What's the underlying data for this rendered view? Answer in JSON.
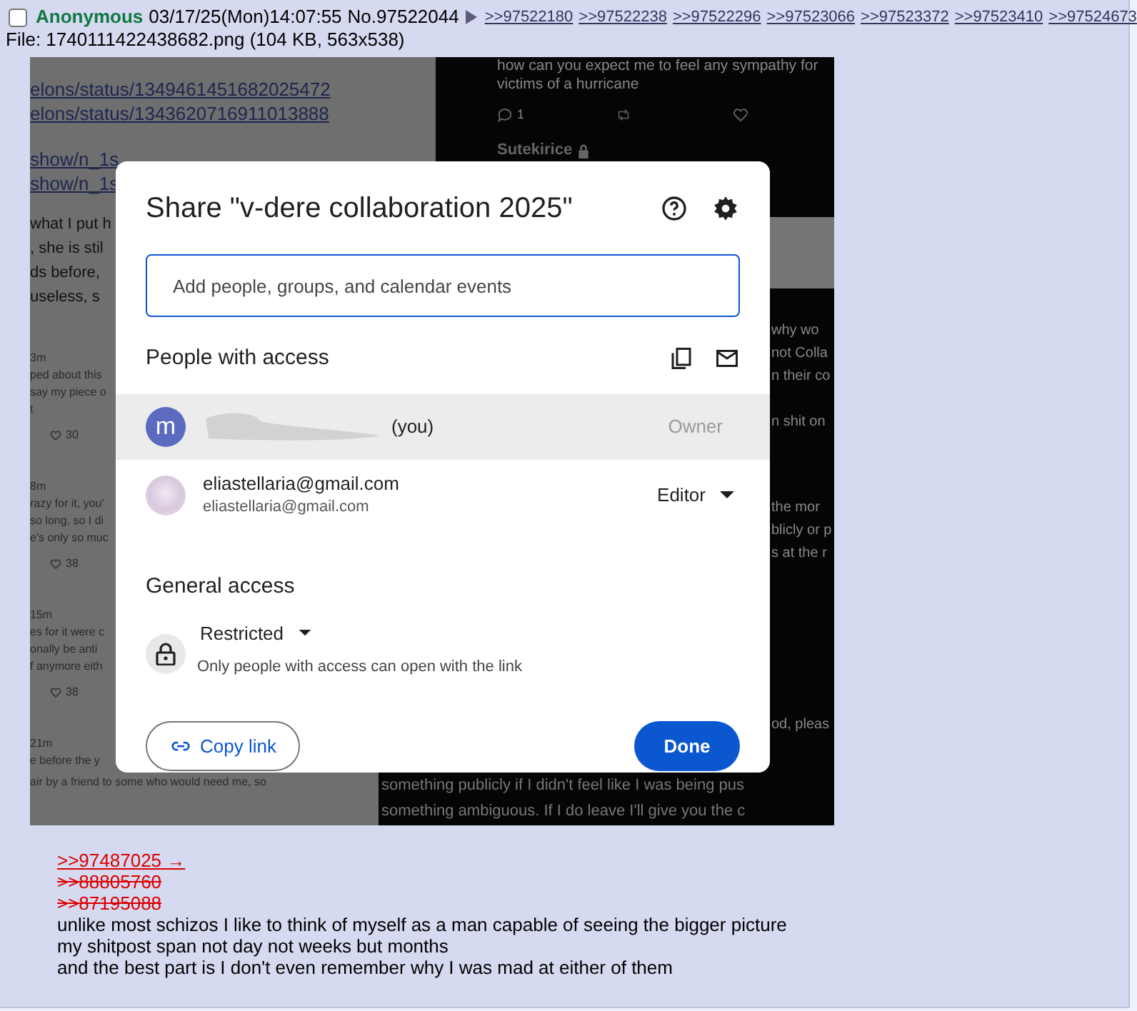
{
  "post": {
    "checked": false,
    "name": "Anonymous",
    "datetime": "03/17/25(Mon)14:07:55",
    "number": "No.97522044",
    "backlinks": [
      ">>97522180",
      ">>97522238",
      ">>97522296",
      ">>97523066",
      ">>97523372",
      ">>97523410",
      ">>97524673"
    ],
    "file": {
      "label": "File:",
      "filename": "1740111422438682.png",
      "meta": "(104 KB, 563x538)"
    },
    "image": {
      "left_links": [
        [
          "elons/status/1349461451682025472",
          "elons/status/1343620716911013888"
        ],
        [
          "show/n_1s",
          "show/n_1s"
        ]
      ],
      "left_post_lines": [
        "what I put h",
        ", she is stil",
        "ds before,",
        "useless, s"
      ],
      "left_tweets": [
        {
          "time": "3m",
          "lines": [
            "ped about this",
            "say my piece o",
            "t"
          ],
          "likes": "30"
        },
        {
          "time": "8m",
          "lines": [
            "razy for it, you'",
            "so long, so I di",
            "e's only so muc"
          ],
          "likes": "38"
        },
        {
          "time": "15m",
          "lines": [
            "es for it were c",
            "onally be anti",
            "f anymore eith"
          ],
          "likes": "38"
        },
        {
          "time": "21m",
          "lines": [
            "e before the y"
          ]
        }
      ],
      "right_tweet": {
        "lines": [
          "how can you expect me to feel any sympathy for",
          "victims of a hurricane"
        ],
        "reply_count": "1",
        "next_author": "Sutekirice"
      },
      "right_fragments": [
        "why wo",
        "not Colla",
        "n their co",
        "n shit on",
        "the mor",
        "blicly or p",
        "s at the r",
        "od, pleas"
      ],
      "bottom_left": [
        "air by a friend to some who would need me, so"
      ],
      "bottom_right": [
        "something publicly if I didn't feel like I was being pus",
        "something ambiguous. If I do leave I'll give you the c"
      ],
      "dialog": {
        "title": "Share \"v-dere collaboration 2025\"",
        "placeholder": "Add people, groups, and calendar events",
        "people_heading": "People with access",
        "people": [
          {
            "kind": "letter",
            "avatar_letter": "m",
            "redacted": true,
            "name": "(you)",
            "role": "Owner",
            "role_menu": false,
            "highlighted": true
          },
          {
            "kind": "picture",
            "redacted": false,
            "name": "eliastellaria@gmail.com",
            "email": "eliastellaria@gmail.com",
            "role": "Editor",
            "role_menu": true,
            "highlighted": false
          }
        ],
        "general_heading": "General access",
        "access": {
          "label": "Restricted",
          "description": "Only people with access can open with the link"
        },
        "copy_button": "Copy link",
        "done_button": "Done"
      }
    },
    "quotes": [
      {
        "text": ">>97487025 →",
        "dead": false
      },
      {
        "text": ">>88805760",
        "dead": true
      },
      {
        "text": ">>87195088",
        "dead": true
      }
    ],
    "lines": [
      "unlike most schizos I like to think of myself as a man capable of seeing the bigger picture",
      "my shitpost span not day not weeks but months",
      "and the best part is I don't even remember why I was mad at either of them"
    ]
  }
}
